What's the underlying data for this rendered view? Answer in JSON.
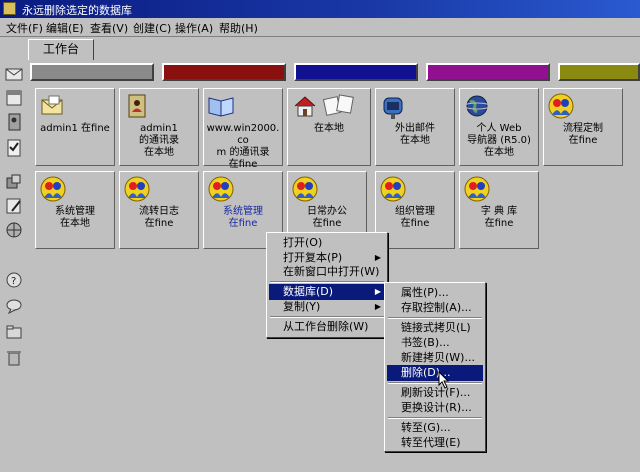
{
  "window": {
    "title": "永远删除选定的数据库"
  },
  "menubar": [
    {
      "label": "文件(F)"
    },
    {
      "label": "编辑(E)"
    },
    {
      "label": "查看(V)"
    },
    {
      "label": "创建(C)"
    },
    {
      "label": "操作(A)"
    },
    {
      "label": "帮助(H)"
    }
  ],
  "tab": {
    "label": "工作台"
  },
  "color_tabs": [
    "#8a8a8a",
    "#8a1010",
    "#101090",
    "#901090",
    "#8a8a10"
  ],
  "tiles_row1": [
    {
      "label": "admin1 在fine",
      "icon": "mail-envelope-icon"
    },
    {
      "label": "admin1\n的通讯录\n在本地",
      "icon": "address-book-icon"
    },
    {
      "label": "www.win2000.co\nm 的通讯录\n在fine",
      "icon": "open-book-icon"
    },
    {
      "label": "在本地",
      "icon": "house-icon"
    },
    {
      "label": "外出邮件\n在本地",
      "icon": "mailbox-icon"
    },
    {
      "label": "个人 Web\n导航器 (R5.0)\n在本地",
      "icon": "globe-icon"
    },
    {
      "label": "流程定制\n在fine",
      "icon": "people-icon"
    }
  ],
  "tiles_row2": [
    {
      "label": "系统管理\n在本地",
      "icon": "people-icon"
    },
    {
      "label": "流转日志\n在fine",
      "icon": "people-icon"
    },
    {
      "label": "系统管理\n在fine",
      "icon": "people-icon"
    },
    {
      "label": "日常办公\n在fine",
      "icon": "people-icon"
    },
    {
      "label": "组织管理\n在fine",
      "icon": "people-icon"
    },
    {
      "label": "字 典 库\n在fine",
      "icon": "people-icon"
    }
  ],
  "context_menu": {
    "items": [
      {
        "label": "打开(O)"
      },
      {
        "label": "打开复本(P)"
      },
      {
        "label": "在新窗口中打开(W)"
      },
      {
        "label": "数据库(D)"
      },
      {
        "label": "复制(Y)"
      },
      {
        "label": "从工作台删除(W)"
      }
    ]
  },
  "submenu": {
    "items": [
      {
        "label": "属性(P)..."
      },
      {
        "label": "存取控制(A)..."
      },
      {
        "label": "链接式拷贝(L)"
      },
      {
        "label": "书签(B)..."
      },
      {
        "label": "新建拷贝(W)..."
      },
      {
        "label": "删除(D)..."
      },
      {
        "label": "刷新设计(F)..."
      },
      {
        "label": "更换设计(R)..."
      },
      {
        "label": "转至(G)..."
      },
      {
        "label": "转至代理(E)"
      }
    ]
  }
}
